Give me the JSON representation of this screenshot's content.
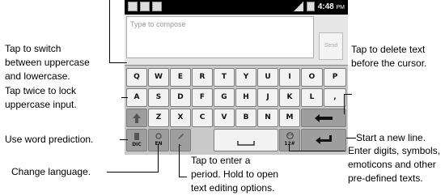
{
  "status_bar": {
    "time": "4:48",
    "ampm": "PM"
  },
  "compose": {
    "placeholder": "Type to compose",
    "send_label": "Send"
  },
  "keyboard": {
    "row1": [
      "Q",
      "W",
      "E",
      "R",
      "T",
      "Y",
      "U",
      "I",
      "O",
      "P"
    ],
    "row2": [
      "A",
      "S",
      "D",
      "F",
      "G",
      "H",
      "J",
      "K",
      "L",
      ","
    ],
    "row3": [
      "Z",
      "X",
      "C",
      "V",
      "B",
      "N",
      "M"
    ],
    "shift_icon": "shift-arrow-icon",
    "delete_icon": "backspace-arrow-icon",
    "enter_icon": "enter-return-icon",
    "dic_label": "DIC",
    "lang_label": "EN",
    "space_icon": "space-bar-icon",
    "symbols_label": "12#",
    "emoticon_icon": "smiley-icon",
    "pencil_icon": "pencil-icon",
    "period_label": "."
  },
  "annotations": {
    "switch_case": [
      "Tap to switch",
      "between uppercase",
      "and lowercase."
    ],
    "lock_case": [
      "Tap twice to lock",
      "uppercase input."
    ],
    "word_prediction": "Use word prediction.",
    "change_language": "Change language.",
    "period": [
      "Tap to enter a",
      "period. Hold to open",
      "text editing options."
    ],
    "delete": [
      "Tap to delete text",
      "before the cursor."
    ],
    "new_line": "Start a new line.",
    "symbols": [
      "Enter digits, symbols,",
      "emoticons and other",
      "pre-defined texts."
    ]
  }
}
